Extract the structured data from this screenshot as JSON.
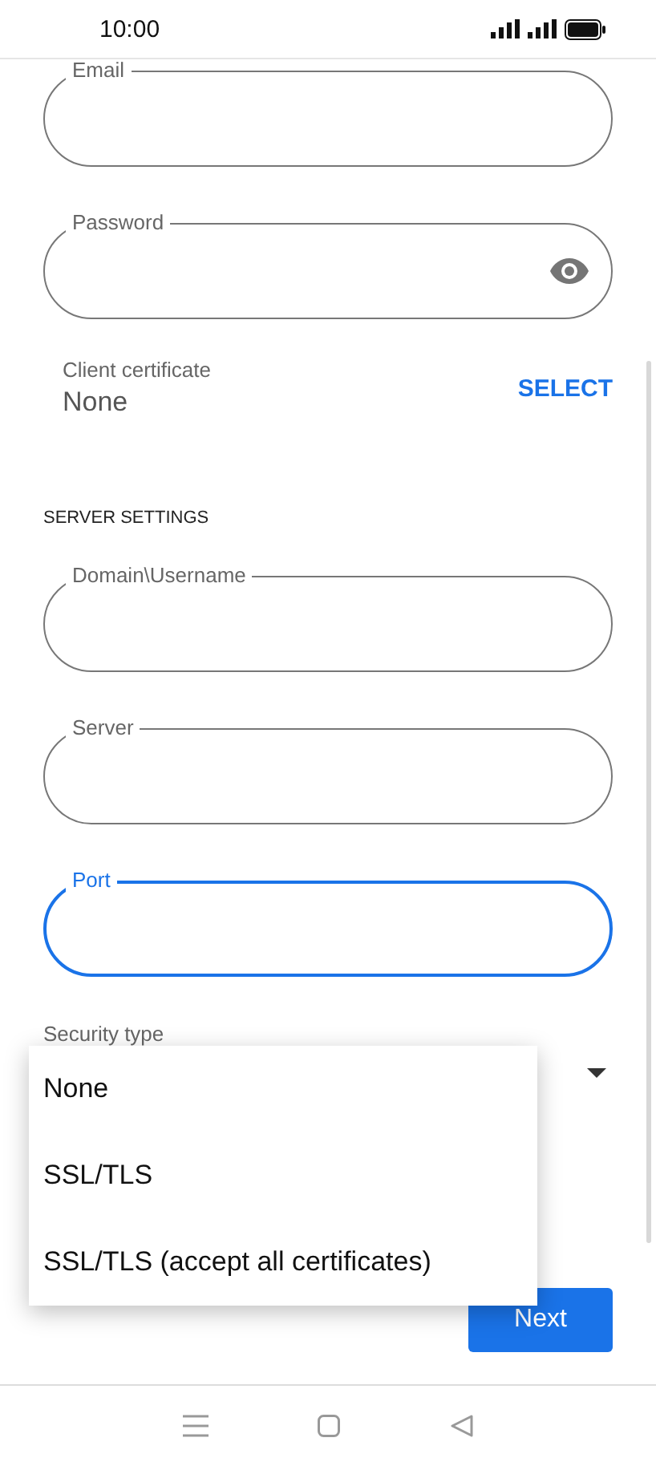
{
  "status_bar": {
    "time": "10:00"
  },
  "account_fields": [
    {
      "label": "Email",
      "kind": "text",
      "focused": false
    },
    {
      "label": "Password",
      "kind": "password",
      "focused": false
    }
  ],
  "client_certificate": {
    "label": "Client certificate",
    "value": "None",
    "action": "SELECT"
  },
  "server_section": {
    "heading": "SERVER SETTINGS",
    "fields": [
      {
        "label": "Domain\\Username",
        "kind": "text",
        "focused": false
      },
      {
        "label": "Server",
        "kind": "text",
        "focused": false
      },
      {
        "label": "Port",
        "kind": "text",
        "focused": true
      }
    ]
  },
  "security_type": {
    "label": "Security type",
    "options": [
      "None",
      "SSL/TLS",
      "SSL/TLS (accept all certificates)"
    ]
  },
  "next_button": "Next"
}
